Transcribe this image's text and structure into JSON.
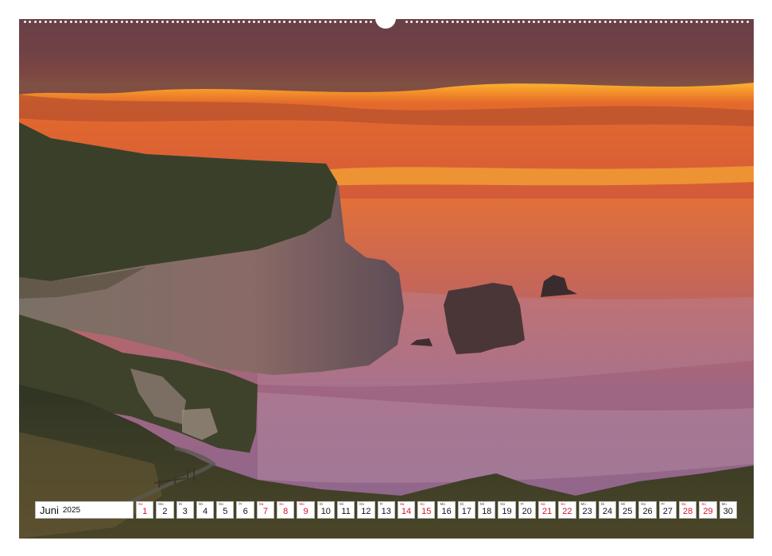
{
  "calendar": {
    "month": "Juni",
    "year": "2025",
    "weekend_color": "#d0142c",
    "days": [
      {
        "dow": "So",
        "num": "1",
        "weekend": true
      },
      {
        "dow": "Mo",
        "num": "2",
        "weekend": false
      },
      {
        "dow": "Di",
        "num": "3",
        "weekend": false
      },
      {
        "dow": "Mi",
        "num": "4",
        "weekend": false
      },
      {
        "dow": "Do",
        "num": "5",
        "weekend": false
      },
      {
        "dow": "Fr",
        "num": "6",
        "weekend": false
      },
      {
        "dow": "Sa",
        "num": "7",
        "weekend": true
      },
      {
        "dow": "So",
        "num": "8",
        "weekend": true
      },
      {
        "dow": "Mo",
        "num": "9",
        "weekend": true
      },
      {
        "dow": "Di",
        "num": "10",
        "weekend": false
      },
      {
        "dow": "Mi",
        "num": "11",
        "weekend": false
      },
      {
        "dow": "Do",
        "num": "12",
        "weekend": false
      },
      {
        "dow": "Fr",
        "num": "13",
        "weekend": false
      },
      {
        "dow": "Sa",
        "num": "14",
        "weekend": true
      },
      {
        "dow": "So",
        "num": "15",
        "weekend": true
      },
      {
        "dow": "Mo",
        "num": "16",
        "weekend": false
      },
      {
        "dow": "Di",
        "num": "17",
        "weekend": false
      },
      {
        "dow": "Mi",
        "num": "18",
        "weekend": false
      },
      {
        "dow": "Do",
        "num": "19",
        "weekend": false
      },
      {
        "dow": "Fr",
        "num": "20",
        "weekend": false
      },
      {
        "dow": "Sa",
        "num": "21",
        "weekend": true
      },
      {
        "dow": "So",
        "num": "22",
        "weekend": true
      },
      {
        "dow": "Mo",
        "num": "23",
        "weekend": false
      },
      {
        "dow": "Di",
        "num": "24",
        "weekend": false
      },
      {
        "dow": "Mi",
        "num": "25",
        "weekend": false
      },
      {
        "dow": "Do",
        "num": "26",
        "weekend": false
      },
      {
        "dow": "Fr",
        "num": "27",
        "weekend": false
      },
      {
        "dow": "Sa",
        "num": "28",
        "weekend": true
      },
      {
        "dow": "So",
        "num": "29",
        "weekend": true
      },
      {
        "dow": "Mo",
        "num": "30",
        "weekend": false
      }
    ]
  },
  "photo": {
    "subject": "coastal-cliffs-sunset",
    "sky_color": "#f6a12c",
    "sea_color": "#9a6a8a",
    "cliff_color": "#3a3a2a"
  }
}
